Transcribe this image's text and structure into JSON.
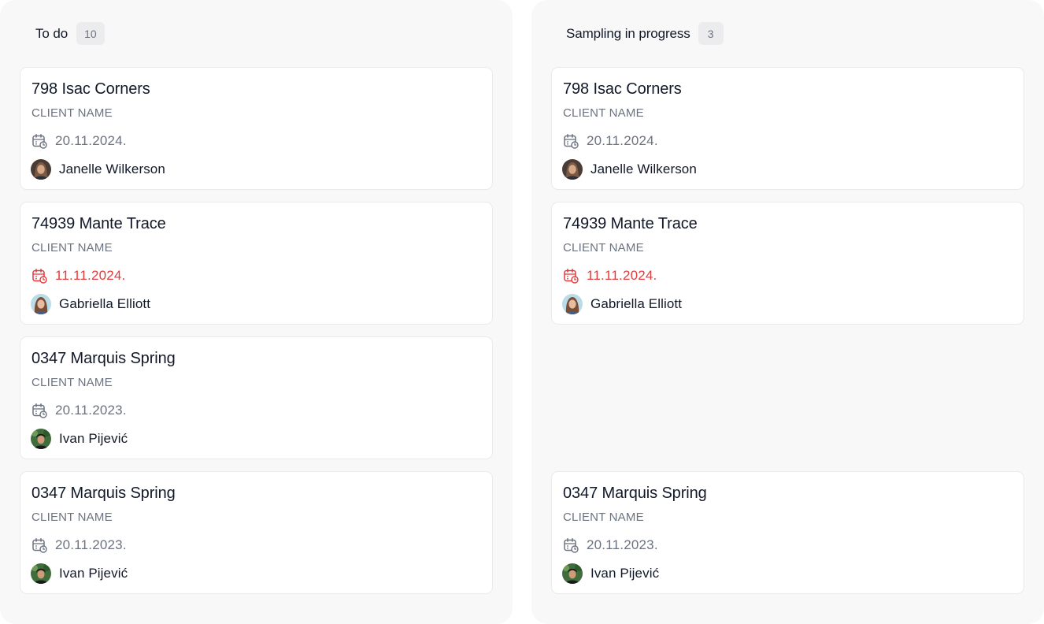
{
  "columns": [
    {
      "title": "To do",
      "count": "10",
      "cards": [
        {
          "title": "798 Isac Corners",
          "client": "CLIENT NAME",
          "date": "20.11.2024.",
          "overdue": false,
          "assignee": "Janelle Wilkerson",
          "avatar": "avatar-janelle"
        },
        {
          "title": "74939 Mante Trace",
          "client": "CLIENT NAME",
          "date": "11.11.2024.",
          "overdue": true,
          "assignee": "Gabriella Elliott",
          "avatar": "avatar-gabriella"
        },
        {
          "title": "0347 Marquis Spring",
          "client": "CLIENT NAME",
          "date": "20.11.2023.",
          "overdue": false,
          "assignee": "Ivan Pijević",
          "avatar": "avatar-ivan"
        },
        {
          "title": "0347 Marquis Spring",
          "client": "CLIENT NAME",
          "date": "20.11.2023.",
          "overdue": false,
          "assignee": "Ivan Pijević",
          "avatar": "avatar-ivan"
        }
      ]
    },
    {
      "title": "Sampling in progress",
      "count": "3",
      "cards": [
        {
          "title": "798 Isac Corners",
          "client": "CLIENT NAME",
          "date": "20.11.2024.",
          "overdue": false,
          "assignee": "Janelle Wilkerson",
          "avatar": "avatar-janelle"
        },
        {
          "title": "74939 Mante Trace",
          "client": "CLIENT NAME",
          "date": "11.11.2024.",
          "overdue": true,
          "assignee": "Gabriella Elliott",
          "avatar": "avatar-gabriella"
        },
        {
          "title": "0347 Marquis Spring",
          "client": "CLIENT NAME",
          "date": "20.11.2023.",
          "overdue": false,
          "assignee": "Ivan Pijević",
          "avatar": "avatar-ivan"
        }
      ]
    }
  ],
  "colors": {
    "column_bg": "#f8f8f9",
    "card_bg": "#ffffff",
    "text_primary": "#111827",
    "text_secondary": "#6b7280",
    "overdue": "#e23b3b",
    "badge_bg": "#ececef"
  },
  "icons": {
    "date": "calendar-clock-icon"
  }
}
